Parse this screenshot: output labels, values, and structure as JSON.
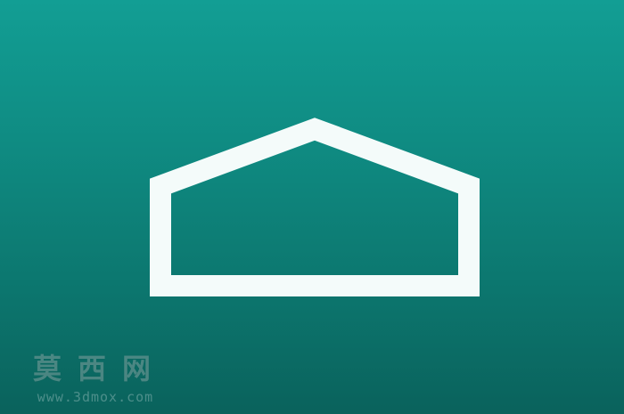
{
  "tile": {
    "background_top": "#129e94",
    "background_bottom": "#0a625c"
  },
  "home_button": {
    "icon": "home-outline-icon",
    "icon_color": "#f4fbfa"
  },
  "watermark": {
    "name": "莫西网",
    "url": "www.3dmox.com"
  }
}
